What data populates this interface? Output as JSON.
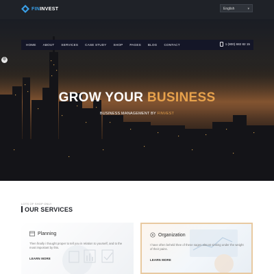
{
  "brand": {
    "prefix": "FIN",
    "suffix": "INVEST",
    "colors": {
      "accent_blue": "#3aa0e8",
      "accent_gold": "#e7a24c",
      "dark": "#1f2228"
    }
  },
  "language": {
    "selected": "English"
  },
  "nav": {
    "items": [
      "HOME",
      "ABOUT",
      "SERVICES",
      "CASE STUDY",
      "SHOP",
      "PAGES",
      "BLOG",
      "CONTACT"
    ],
    "phone": "1 (800) 682 82 15"
  },
  "hero": {
    "title_main": "GROW YOUR ",
    "title_accent": "BUSINESS",
    "subtitle_main": "BUSINESS MANAGEMENT BY ",
    "subtitle_accent": "FINVEST"
  },
  "services": {
    "eyebrow": "LOTS OF SHOP ONLY",
    "title": "OUR SERVICES",
    "cards": [
      {
        "icon": "planning-icon",
        "title": "Planning",
        "text": "Then finally i thought proper to tell you in relation to yourself, and to the most important by this.",
        "link": "LEARN MORE"
      },
      {
        "icon": "organization-icon",
        "title": "Organization",
        "text": "I have often beheld thee of these sages almost sinking under the weight of their pains.",
        "link": "LEARN MORE"
      }
    ]
  }
}
